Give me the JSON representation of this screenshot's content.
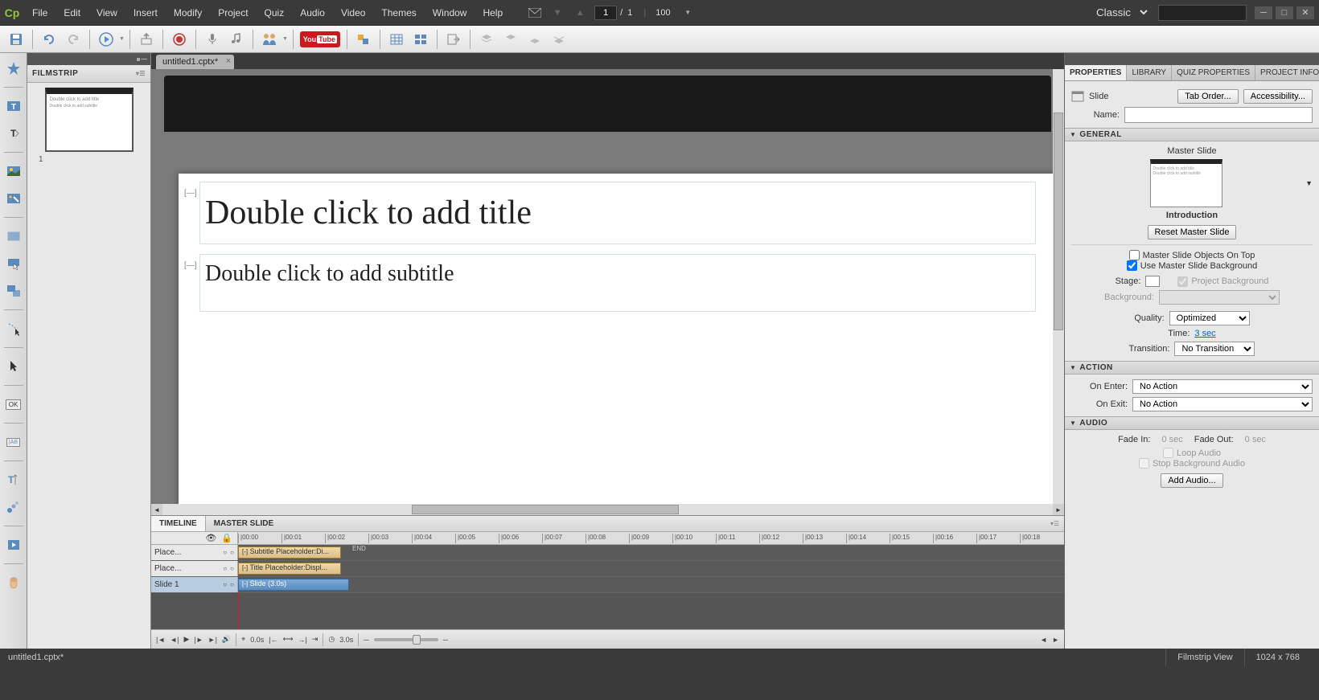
{
  "menu": {
    "items": [
      "File",
      "Edit",
      "View",
      "Insert",
      "Modify",
      "Project",
      "Quiz",
      "Audio",
      "Video",
      "Themes",
      "Window",
      "Help"
    ],
    "page_current": "1",
    "page_total": "1",
    "zoom": "100",
    "workspace": "Classic"
  },
  "doc": {
    "tab": "untitled1.cptx*"
  },
  "filmstrip": {
    "title": "FILMSTRIP",
    "thumb_title": "Double click to add title",
    "thumb_sub": "Double click to add subtitle",
    "num": "1"
  },
  "slide": {
    "title_ph": "Double click to add title",
    "subtitle_ph": "Double click to add subtitle"
  },
  "timeline": {
    "tabs": [
      "TIMELINE",
      "MASTER SLIDE"
    ],
    "ticks": [
      "|00:00",
      "|00:01",
      "|00:02",
      "|00:03",
      "|00:04",
      "|00:05",
      "|00:06",
      "|00:07",
      "|00:08",
      "|00:09",
      "|00:10",
      "|00:11",
      "|00:12",
      "|00:13",
      "|00:14",
      "|00:15",
      "|00:16",
      "|00:17",
      "|00:18"
    ],
    "rows": [
      {
        "head": "Place...",
        "clip": "Subtitle Placeholder:Di..."
      },
      {
        "head": "Place...",
        "clip": "Title Placeholder:Displ..."
      },
      {
        "head": "Slide 1",
        "clip": "Slide (3.0s)",
        "blue": true
      }
    ],
    "end": "END",
    "playtime": "0.0s",
    "cliptime": "3.0s"
  },
  "props": {
    "tabs": [
      "PROPERTIES",
      "LIBRARY",
      "QUIZ PROPERTIES",
      "PROJECT INFO"
    ],
    "obj_type": "Slide",
    "tab_order": "Tab Order...",
    "accessibility": "Accessibility...",
    "name_label": "Name:",
    "name_value": "",
    "general": {
      "hdr": "GENERAL",
      "master_label": "Master Slide",
      "intro": "Introduction",
      "reset": "Reset Master Slide",
      "chk_top": "Master Slide Objects On Top",
      "chk_bg": "Use Master Slide Background",
      "stage": "Stage:",
      "proj_bg": "Project Background",
      "bg": "Background:",
      "quality": "Quality:",
      "quality_v": "Optimized",
      "time": "Time:",
      "time_v": "3 sec",
      "transition": "Transition:",
      "transition_v": "No Transition"
    },
    "action": {
      "hdr": "ACTION",
      "enter": "On Enter:",
      "enter_v": "No Action",
      "exit": "On Exit:",
      "exit_v": "No Action"
    },
    "audio": {
      "hdr": "AUDIO",
      "fadein": "Fade In:",
      "fadein_v": "0 sec",
      "fadeout": "Fade Out:",
      "fadeout_v": "0 sec",
      "loop": "Loop Audio",
      "stop": "Stop Background Audio",
      "add": "Add Audio..."
    }
  },
  "status": {
    "file": "untitled1.cptx*",
    "view": "Filmstrip View",
    "dims": "1024 x 768"
  }
}
